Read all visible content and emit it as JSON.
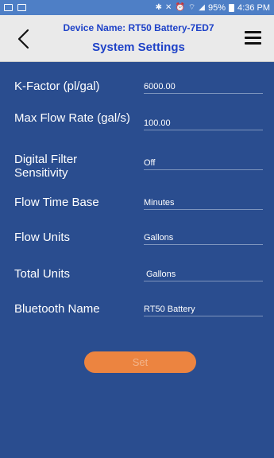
{
  "status_bar": {
    "battery": "95%",
    "time": "4:36 PM"
  },
  "header": {
    "device_name": "Device Name: RT50 Battery-7ED7",
    "title": "System Settings"
  },
  "settings": [
    {
      "label": "K-Factor (pl/gal)",
      "value": "6000.00"
    },
    {
      "label": "Max Flow Rate (gal/s)",
      "value": "100.00"
    },
    {
      "label": "Digital Filter Sensitivity",
      "value": "Off"
    },
    {
      "label": "Flow Time Base",
      "value": "Minutes"
    },
    {
      "label": "Flow Units",
      "value": "Gallons"
    },
    {
      "label": "Total Units",
      "value": "Gallons"
    },
    {
      "label": "Bluetooth Name",
      "value": "RT50 Battery"
    }
  ],
  "actions": {
    "set_label": "Set"
  },
  "colors": {
    "background": "#2a4d8f",
    "header": "#eaeaea",
    "accent": "#1e42c8",
    "button": "#ec8440"
  }
}
